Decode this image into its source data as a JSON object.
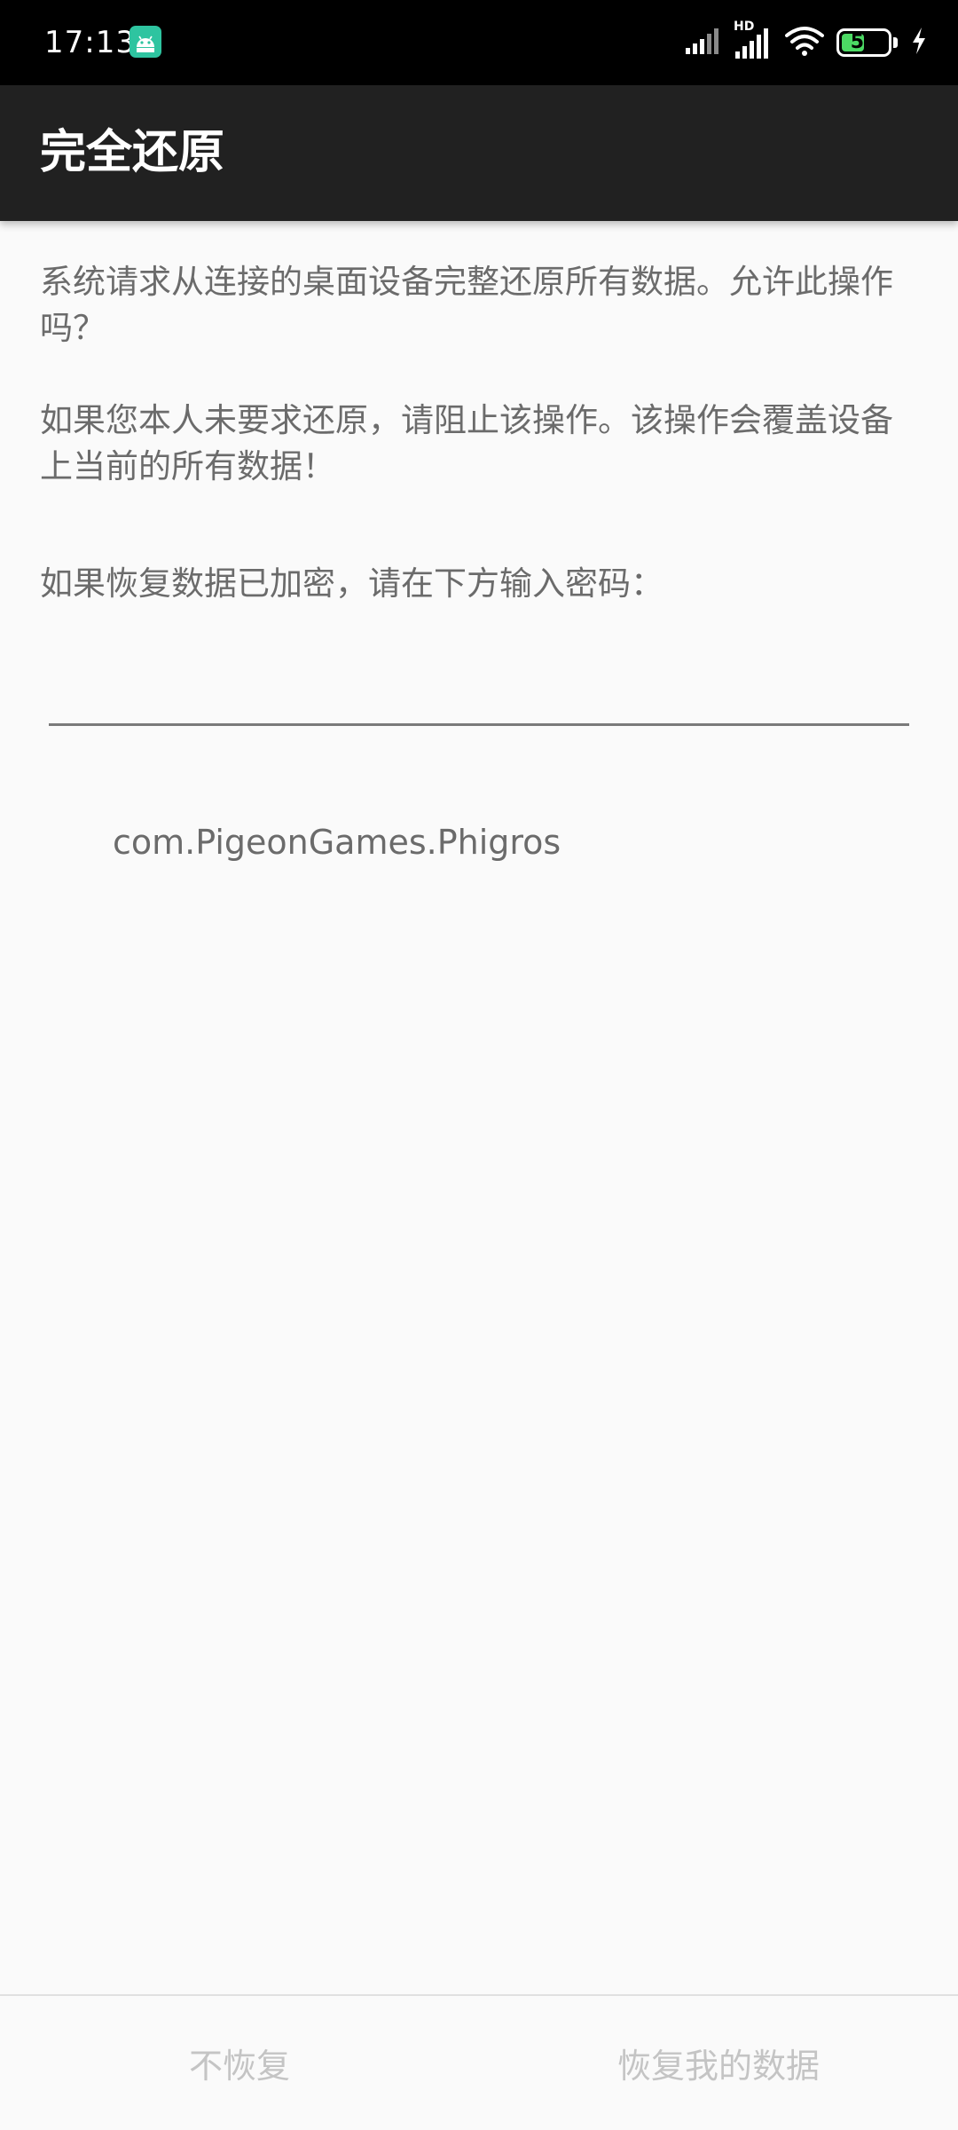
{
  "status_bar": {
    "time": "17:13",
    "battery_level": "50",
    "battery_percent": 50,
    "network_badge": "HD",
    "app_icon": "android-icon",
    "icons": [
      "signal-icon",
      "signal-hd-icon",
      "wifi-icon",
      "battery-icon",
      "charging-icon"
    ]
  },
  "app_bar": {
    "title": "完全还原"
  },
  "content": {
    "paragraph_1": "系统请求从连接的桌面设备完整还原所有数据。允许此操作吗？",
    "paragraph_2": "如果您本人未要求还原，请阻止该操作。该操作会覆盖设备上当前的所有数据！",
    "paragraph_3": "如果恢复数据已加密，请在下方输入密码：",
    "password_value": "",
    "package_name": "com.PigeonGames.Phigros"
  },
  "buttons": {
    "deny_label": "不恢复",
    "allow_label": "恢复我的数据"
  },
  "colors": {
    "status_bar_bg": "#000000",
    "app_bar_bg": "#212121",
    "page_bg": "#fafafa",
    "body_text": "#6b6b6b",
    "disabled_button_text": "#c4c4c4",
    "battery_fill": "#4cd964",
    "app_icon_color": "#2ec4a0"
  }
}
